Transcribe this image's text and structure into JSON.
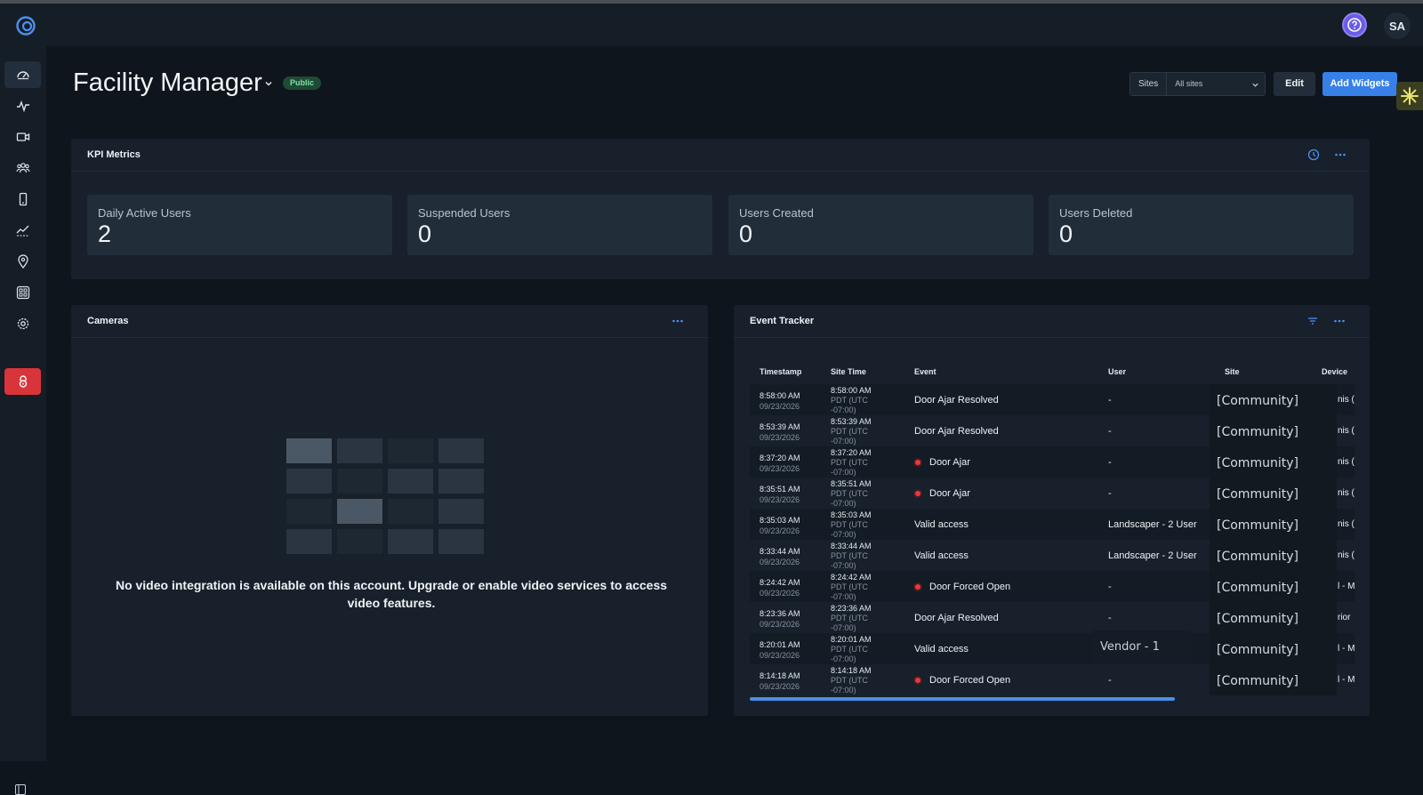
{
  "header": {
    "avatar_initials": "SA"
  },
  "page": {
    "title": "Facility Manager",
    "visibility_badge": "Public"
  },
  "toolbar": {
    "sites_label": "Sites",
    "sites_value": "All sites",
    "edit_label": "Edit",
    "add_widgets_label": "Add Widgets"
  },
  "kpi": {
    "title": "KPI Metrics",
    "metrics": [
      {
        "label": "Daily Active Users",
        "value": "2"
      },
      {
        "label": "Suspended Users",
        "value": "0"
      },
      {
        "label": "Users Created",
        "value": "0"
      },
      {
        "label": "Users Deleted",
        "value": "0"
      }
    ]
  },
  "cameras": {
    "title": "Cameras",
    "empty_message": "No video integration is available on this account. Upgrade or enable video services to access video features."
  },
  "events": {
    "title": "Event Tracker",
    "columns": [
      "Timestamp",
      "Site Time",
      "Event",
      "User",
      "Site",
      "Device"
    ],
    "rows": [
      {
        "time": "8:58:00 AM",
        "date": "09/23/2026",
        "site_time": "8:58:00 AM",
        "tz1": "PDT (UTC",
        "tz2": "-07:00)",
        "event": "Door Ajar Resolved",
        "alert": false,
        "user": "-",
        "site": "[Community]",
        "device": "nis ("
      },
      {
        "time": "8:53:39 AM",
        "date": "09/23/2026",
        "site_time": "8:53:39 AM",
        "tz1": "PDT (UTC",
        "tz2": "-07:00)",
        "event": "Door Ajar Resolved",
        "alert": false,
        "user": "-",
        "site": "[Community]",
        "device": "nis ("
      },
      {
        "time": "8:37:20 AM",
        "date": "09/23/2026",
        "site_time": "8:37:20 AM",
        "tz1": "PDT (UTC",
        "tz2": "-07:00)",
        "event": "Door Ajar",
        "alert": true,
        "user": "-",
        "site": "[Community]",
        "device": "nis ("
      },
      {
        "time": "8:35:51 AM",
        "date": "09/23/2026",
        "site_time": "8:35:51 AM",
        "tz1": "PDT (UTC",
        "tz2": "-07:00)",
        "event": "Door Ajar",
        "alert": true,
        "user": "-",
        "site": "[Community]",
        "device": "nis ("
      },
      {
        "time": "8:35:03 AM",
        "date": "09/23/2026",
        "site_time": "8:35:03 AM",
        "tz1": "PDT (UTC",
        "tz2": "-07:00)",
        "event": "Valid access",
        "alert": false,
        "user": "Landscaper - 2 User",
        "site": "[Community]",
        "device": "nis ("
      },
      {
        "time": "8:33:44 AM",
        "date": "09/23/2026",
        "site_time": "8:33:44 AM",
        "tz1": "PDT (UTC",
        "tz2": "-07:00)",
        "event": "Valid access",
        "alert": false,
        "user": "Landscaper - 2 User",
        "site": "[Community]",
        "device": "nis ("
      },
      {
        "time": "8:24:42 AM",
        "date": "09/23/2026",
        "site_time": "8:24:42 AM",
        "tz1": "PDT (UTC",
        "tz2": "-07:00)",
        "event": "Door Forced Open",
        "alert": true,
        "user": "-",
        "site": "[Community]",
        "device": "l - M"
      },
      {
        "time": "8:23:36 AM",
        "date": "09/23/2026",
        "site_time": "8:23:36 AM",
        "tz1": "PDT (UTC",
        "tz2": "-07:00)",
        "event": "Door Ajar Resolved",
        "alert": false,
        "user": "-",
        "site": "[Community]",
        "device": "rior"
      },
      {
        "time": "8:20:01 AM",
        "date": "09/23/2026",
        "site_time": "8:20:01 AM",
        "tz1": "PDT (UTC",
        "tz2": "-07:00)",
        "event": "Valid access",
        "alert": false,
        "user": "",
        "site": "[Community]",
        "device": "l - M"
      },
      {
        "time": "8:14:18 AM",
        "date": "09/23/2026",
        "site_time": "8:14:18 AM",
        "tz1": "PDT (UTC",
        "tz2": "-07:00)",
        "event": "Door Forced Open",
        "alert": true,
        "user": "-",
        "site": "[Community]",
        "device": "l - M"
      }
    ],
    "hover_tooltip": "Vendor - 1"
  },
  "colors": {
    "accent": "#3680e8",
    "alert": "#e8393e",
    "badge_bg": "#1f4a36",
    "badge_text": "#7fe0a8",
    "danger_nav": "#d8343a"
  },
  "icons": {
    "sidebar": [
      "dashboard-icon",
      "activity-icon",
      "video-camera-icon",
      "users-icon",
      "mobile-device-icon",
      "analytics-icon",
      "location-pin-icon",
      "apps-grid-icon",
      "settings-gear-icon",
      "lockdown-icon"
    ]
  }
}
